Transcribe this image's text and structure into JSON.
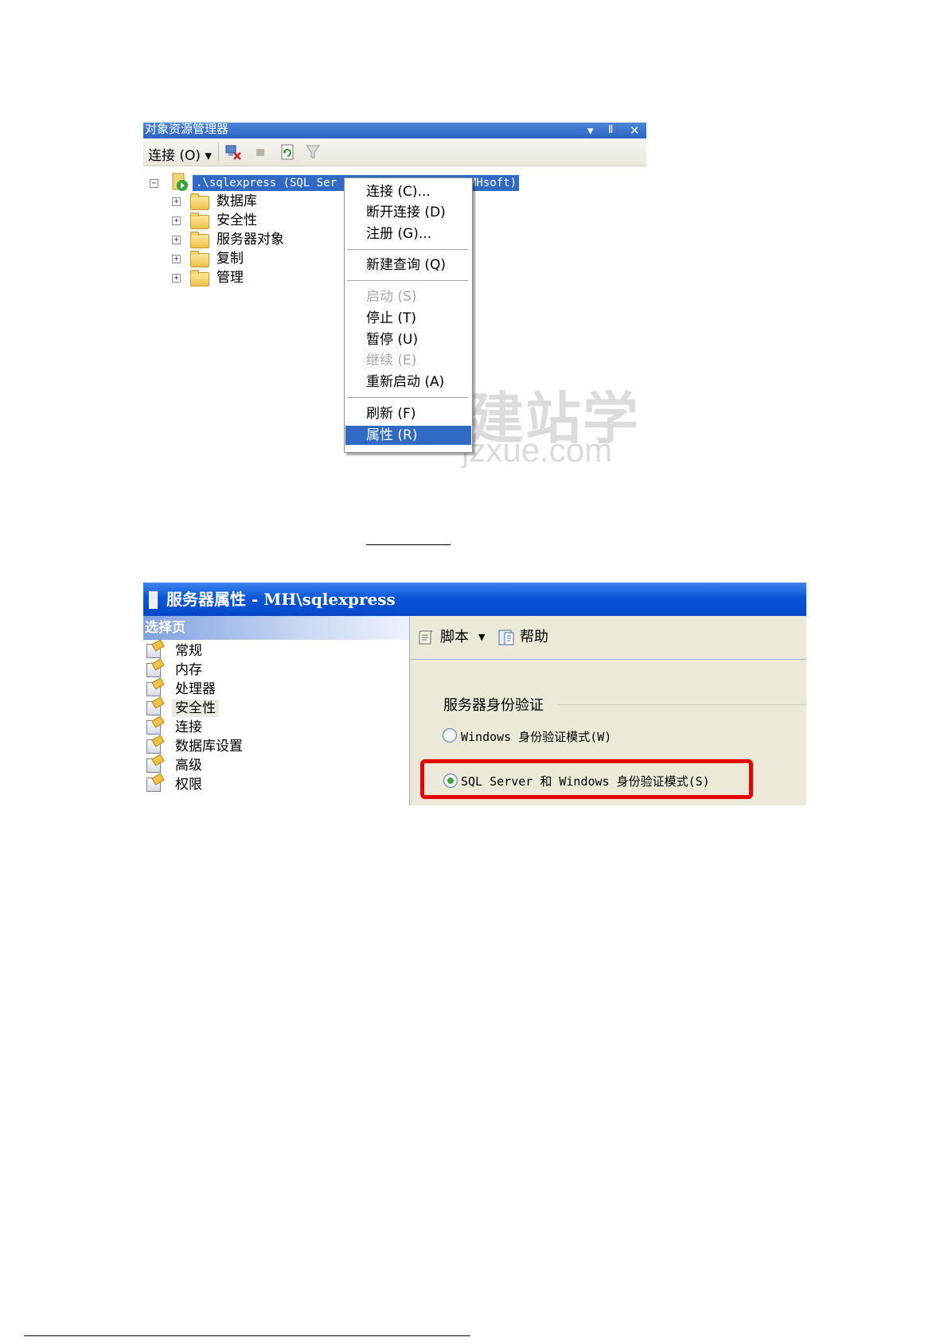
{
  "object_explorer": {
    "title": "对象资源管理器",
    "title_controls": [
      "▾",
      "Ⅱ",
      "✕"
    ],
    "toolbar": {
      "connect_label": "连接 (O) ▾"
    },
    "server_node": ".\\sqlexpress (SQL Ser",
    "server_node_tail": "MHsoft)",
    "tree_items": [
      "数据库",
      "安全性",
      "服务器对象",
      "复制",
      "管理"
    ],
    "context_menu": {
      "connect": "连接 (C)...",
      "disconnect": "断开连接 (D)",
      "register": "注册 (G)...",
      "new_query": "新建查询 (Q)",
      "start": "启动 (S)",
      "stop": "停止 (T)",
      "pause": "暂停 (U)",
      "resume": "继续 (E)",
      "restart": "重新启动 (A)",
      "refresh": "刷新 (F)",
      "properties": "属性 (R)"
    },
    "watermark": {
      "cn": "建站学",
      "en": "jzxue.com"
    }
  },
  "server_properties": {
    "title": "服务器属性 - MH\\sqlexpress",
    "select_page_header": "选择页",
    "pages": [
      "常规",
      "内存",
      "处理器",
      "安全性",
      "连接",
      "数据库设置",
      "高级",
      "权限"
    ],
    "active_page": "安全性",
    "toolbar": {
      "script_label": "脚本",
      "help_label": "帮助"
    },
    "auth_group_label": "服务器身份验证",
    "auth_options": [
      {
        "label": "Windows 身份验证模式(W)",
        "selected": false
      },
      {
        "label": "SQL Server 和 Windows 身份验证模式(S)",
        "selected": true
      }
    ],
    "highlight_color": "#e60000"
  },
  "colors": {
    "title_blue": "#316ac5",
    "xp_title": "#0a56d8",
    "panel_bg": "#ece9d8"
  }
}
